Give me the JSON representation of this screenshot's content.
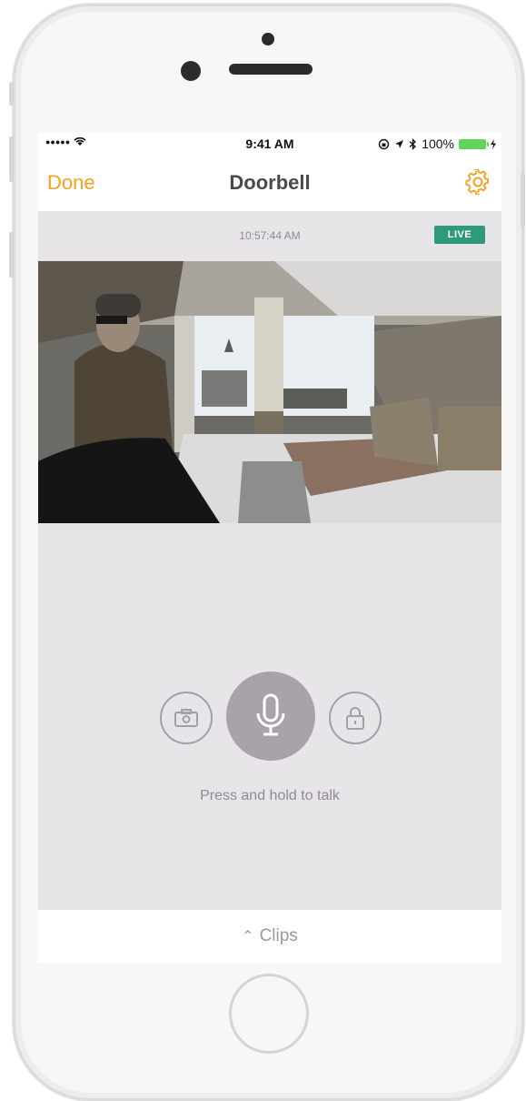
{
  "status_bar": {
    "signal": "●●●●●",
    "time": "9:41 AM",
    "battery_text": "100%"
  },
  "nav": {
    "done_label": "Done",
    "title": "Doorbell",
    "settings_icon": "gear-icon"
  },
  "video": {
    "timestamp": "10:57:44 AM",
    "live_label": "LIVE"
  },
  "controls": {
    "snapshot_icon": "camera-icon",
    "talk_icon": "microphone-icon",
    "lock_icon": "lock-icon",
    "hint": "Press and hold to talk"
  },
  "clips": {
    "label": "Clips"
  },
  "colors": {
    "accent": "#f4a21f",
    "live": "#2f9a7a",
    "background": "#e8e5e9"
  }
}
